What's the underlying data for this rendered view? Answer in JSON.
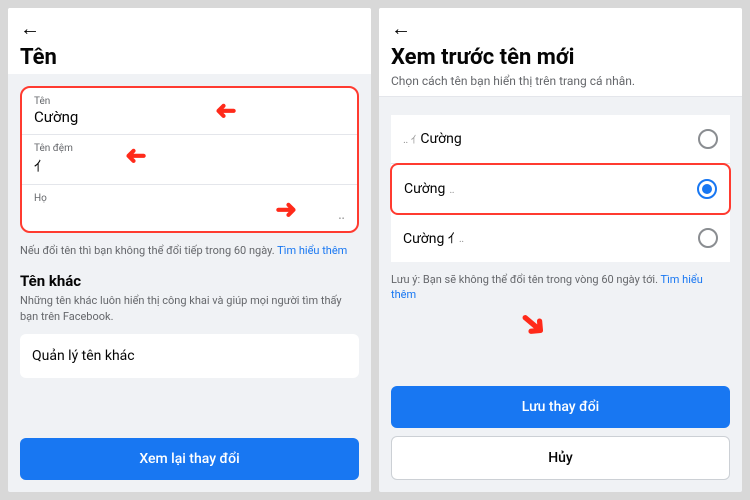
{
  "left": {
    "title": "Tên",
    "fields": {
      "firstLabel": "Tên",
      "firstValue": "Cường",
      "middleLabel": "Tên đệm",
      "middleValue": "ｲ",
      "lastLabel": "Họ",
      "lastValue": "‥"
    },
    "hint": "Nếu đổi tên thì bạn không thể đổi tiếp trong 60 ngày.",
    "hintLink": "Tìm hiểu thêm",
    "otherTitle": "Tên khác",
    "otherDesc": "Những tên khác luôn hiển thị công khai và giúp mọi người tìm thấy bạn trên Facebook.",
    "manage": "Quản lý tên khác",
    "review": "Xem lại thay đổi"
  },
  "right": {
    "title": "Xem trước tên mới",
    "subtitle": "Chọn cách tên bạn hiển thị trên trang cá nhân.",
    "options": {
      "o1prefix": "‥ ｲ ",
      "o1": "Cường",
      "o2": "Cường",
      "o2suffix": " ‥",
      "o3": "Cường ｲ",
      "o3suffix": " ‥"
    },
    "note": "Lưu ý: Bạn sẽ không thể đổi tên trong vòng 60 ngày tới.",
    "noteLink": "Tìm hiểu thêm",
    "save": "Lưu thay đổi",
    "cancel": "Hủy"
  }
}
